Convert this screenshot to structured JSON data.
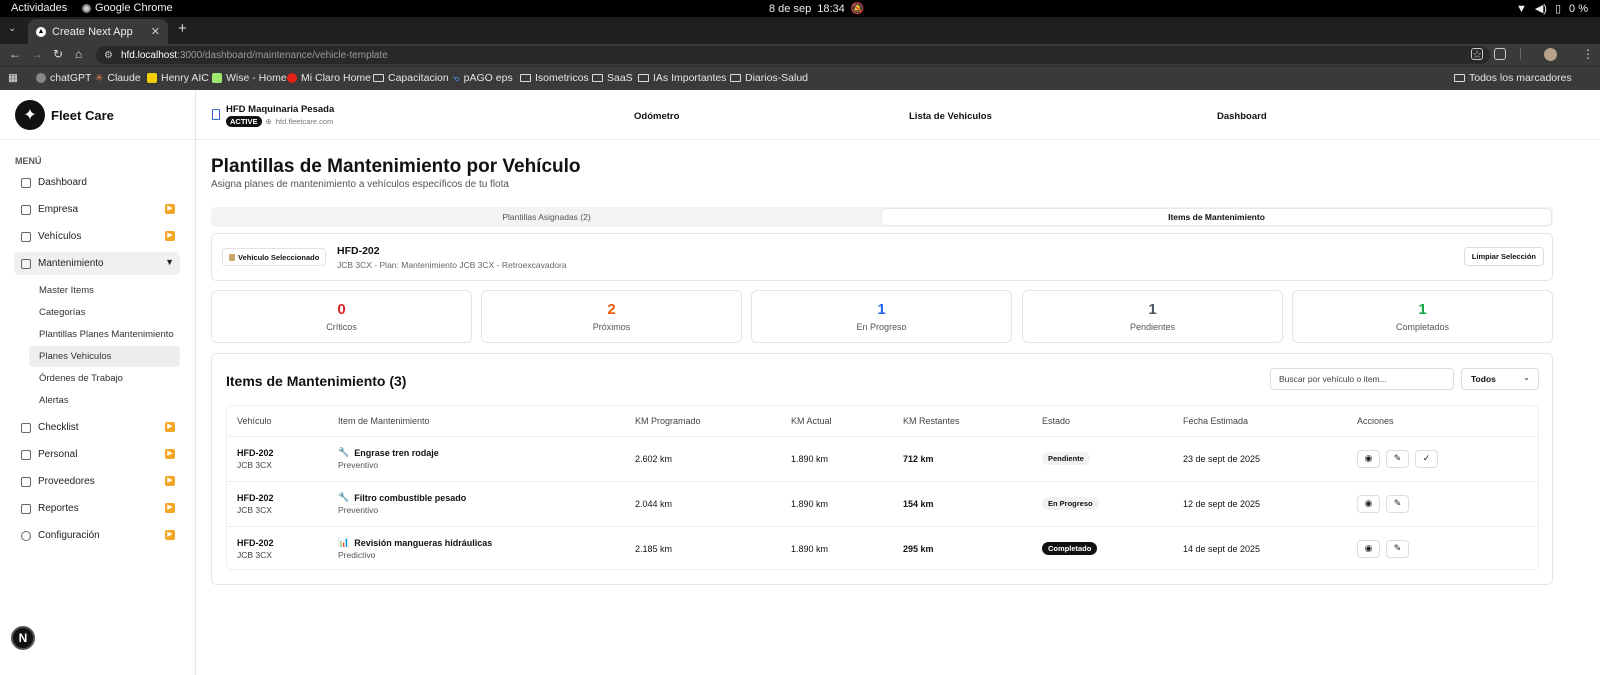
{
  "os": {
    "activities": "Actividades",
    "app": "Google Chrome",
    "date": "8 de sep",
    "time": "18:34",
    "battery": "0 %"
  },
  "browser": {
    "tab_title": "Create Next App",
    "url_host": "hfd.localhost",
    "url_path": ":3000/dashboard/maintenance/vehicle-template",
    "bookmarks": [
      "chatGPT",
      "Claude",
      "Henry AIC",
      "Wise - Home",
      "Mi Claro Home",
      "Capacitacion",
      "pAGO eps",
      "Isometricos",
      "SaaS",
      "IAs Importantes",
      "Diarios-Salud"
    ],
    "all_bookmarks": "Todos los marcadores"
  },
  "sidebar": {
    "brand": "Fleet Care",
    "menu_label": "MENÚ",
    "items": [
      {
        "label": "Dashboard"
      },
      {
        "label": "Empresa"
      },
      {
        "label": "Vehículos"
      },
      {
        "label": "Mantenimiento"
      },
      {
        "label": "Checklist"
      },
      {
        "label": "Personal"
      },
      {
        "label": "Proveedores"
      },
      {
        "label": "Reportes"
      },
      {
        "label": "Configuración"
      }
    ],
    "sub_items": [
      {
        "label": "Master Items"
      },
      {
        "label": "Categorías"
      },
      {
        "label": "Plantillas Planes Mantenimiento"
      },
      {
        "label": "Planes Vehiculos"
      },
      {
        "label": "Órdenes de Trabajo"
      },
      {
        "label": "Alertas"
      }
    ],
    "next_badge": "N"
  },
  "header": {
    "company": "HFD Maquinaria Pesada",
    "status": "ACTIVE",
    "domain": "hfd.fleetcare.com",
    "links": [
      "Odómetro",
      "Lista de Vehiculos",
      "Dashboard"
    ]
  },
  "page": {
    "title": "Plantillas de Mantenimiento por Vehículo",
    "subtitle": "Asigna planes de mantenimiento a vehículos específicos de tu flota",
    "tabs": [
      "Plantillas Asignadas (2)",
      "Items de Mantenimiento"
    ]
  },
  "vehicle": {
    "badge": "Vehículo Seleccionado",
    "code": "HFD-202",
    "description": "JCB 3CX - Plan: Mantenimiento JCB 3CX - Retroexcavadora",
    "clear_button": "Limpiar Selección"
  },
  "stats": [
    {
      "value": "0",
      "label": "Críticos",
      "color": "#dc2626"
    },
    {
      "value": "2",
      "label": "Próximos",
      "color": "#ea580c"
    },
    {
      "value": "1",
      "label": "En Progreso",
      "color": "#2563eb"
    },
    {
      "value": "1",
      "label": "Pendientes",
      "color": "#4b5563"
    },
    {
      "value": "1",
      "label": "Completados",
      "color": "#16a34a"
    }
  ],
  "items": {
    "title": "Items de Mantenimiento (3)",
    "search_placeholder": "Buscar por vehículo o item...",
    "filter_value": "Todos",
    "columns": [
      "Vehículo",
      "Item de Mantenimiento",
      "KM Programado",
      "KM Actual",
      "KM Restantes",
      "Estado",
      "Fecha Estimada",
      "Acciones"
    ],
    "rows": [
      {
        "code": "HFD-202",
        "model": "JCB 3CX",
        "icon": "wrench-icon",
        "glyph": "🔧",
        "name": "Engrase tren rodaje",
        "type": "Preventivo",
        "km_prog": "2.602 km",
        "km_actual": "1.890 km",
        "km_rest": "712 km",
        "status": "Pendiente",
        "date": "23 de sept de 2025"
      },
      {
        "code": "HFD-202",
        "model": "JCB 3CX",
        "icon": "wrench-icon",
        "glyph": "🔧",
        "name": "Filtro combustible pesado",
        "type": "Preventivo",
        "km_prog": "2.044 km",
        "km_actual": "1.890 km",
        "km_rest": "154 km",
        "status": "En Progreso",
        "date": "12 de sept de 2025"
      },
      {
        "code": "HFD-202",
        "model": "JCB 3CX",
        "icon": "chart-icon",
        "glyph": "📊",
        "name": "Revisión mangueras hidráulicas",
        "type": "Predictivo",
        "km_prog": "2.185 km",
        "km_actual": "1.890 km",
        "km_rest": "295 km",
        "status": "Completado",
        "date": "14 de sept de 2025"
      }
    ]
  }
}
